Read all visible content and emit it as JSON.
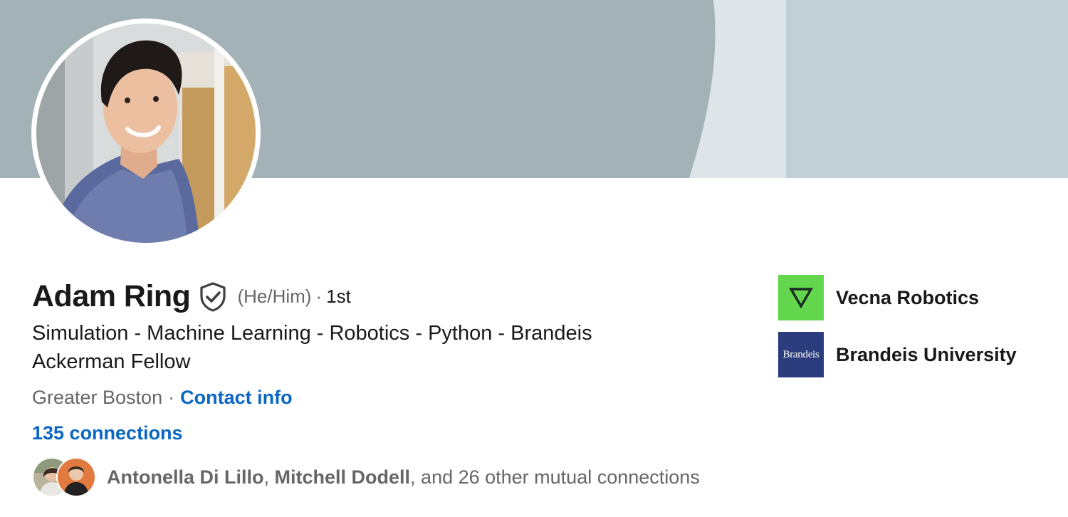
{
  "profile": {
    "name": "Adam Ring",
    "pronouns": "(He/Him)",
    "separator": "·",
    "degree": "1st",
    "headline": "Simulation - Machine Learning - Robotics - Python - Brandeis Ackerman Fellow",
    "location": "Greater Boston",
    "contact_label": "Contact info",
    "connections_label": "135 connections"
  },
  "mutual": {
    "name_1": "Antonella Di Lillo",
    "sep_1": ", ",
    "name_2": "Mitchell Dodell",
    "rest": ", and 26 other mutual connections"
  },
  "orgs": [
    {
      "name": "Vecna Robotics",
      "logo_icon": "vecna-logo-icon",
      "color": "#62d64d"
    },
    {
      "name": "Brandeis University",
      "logo_icon": "brandeis-logo-icon",
      "logo_text": "Brandeis",
      "color": "#2b3d7d"
    }
  ],
  "colors": {
    "link": "#0a66c2",
    "banner_dark": "#a3b2b7",
    "banner_mid": "#dde5e8",
    "banner_light": "#c1d0d5"
  }
}
